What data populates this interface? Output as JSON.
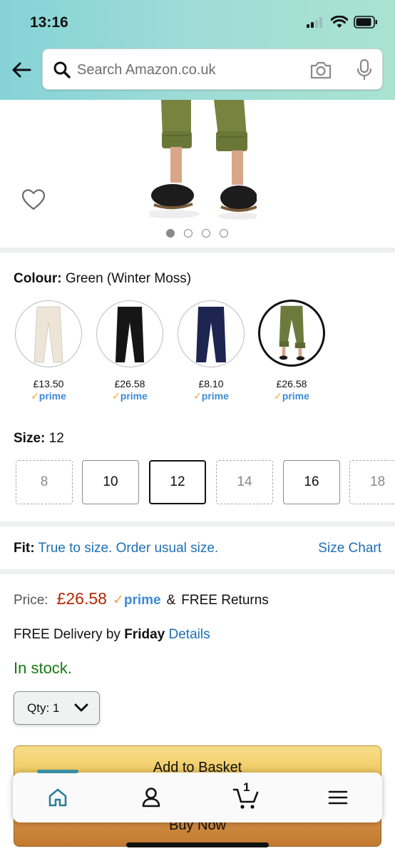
{
  "status_bar": {
    "time": "13:16"
  },
  "search": {
    "placeholder": "Search Amazon.co.uk"
  },
  "gallery": {
    "image_count": 4,
    "active_index": 0
  },
  "colour": {
    "label": "Colour:",
    "value": "Green (Winter Moss)",
    "swatches": [
      {
        "price": "£13.50",
        "prime": "prime",
        "color": "#ece5d8"
      },
      {
        "price": "£26.58",
        "prime": "prime",
        "color": "#151515"
      },
      {
        "price": "£8.10",
        "prime": "prime",
        "color": "#1d2550"
      },
      {
        "price": "£26.58",
        "prime": "prime",
        "color": "#6e7a3d"
      }
    ],
    "selected_index": 3
  },
  "size": {
    "label": "Size:",
    "value": "12",
    "options": [
      {
        "label": "8",
        "available": false
      },
      {
        "label": "10",
        "available": true
      },
      {
        "label": "12",
        "available": true
      },
      {
        "label": "14",
        "available": false
      },
      {
        "label": "16",
        "available": true
      },
      {
        "label": "18",
        "available": false
      }
    ],
    "selected_index": 2
  },
  "fit": {
    "label": "Fit:",
    "value": "True to size. Order usual size.",
    "size_chart": "Size Chart"
  },
  "price": {
    "label": "Price:",
    "value": "£26.58",
    "prime": "prime",
    "amp": "&",
    "free_returns": "FREE Returns"
  },
  "delivery": {
    "prefix": "FREE Delivery by",
    "day": "Friday",
    "details": "Details"
  },
  "stock": "In stock.",
  "quantity": {
    "label": "Qty:",
    "value": "1"
  },
  "buttons": {
    "add_to_basket": "Add to Basket",
    "buy_now": "Buy Now"
  },
  "bottom_nav": {
    "cart_count": "1"
  },
  "colors": {
    "accent": "#1f6fb5",
    "price": "#b12704",
    "stock": "#157a0f",
    "prime": "#3d8ad6",
    "basket": "#f0c14b",
    "buy_now": "#c27a30"
  }
}
